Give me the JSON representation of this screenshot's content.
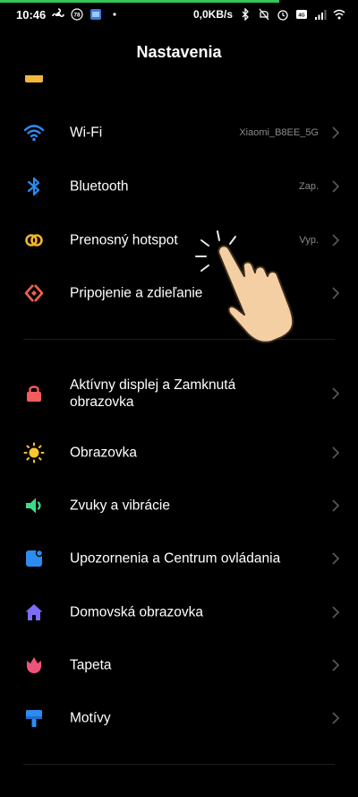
{
  "status_bar": {
    "time": "10:46",
    "badge": "78",
    "speed": "0,0KB/s",
    "progress": 0.78
  },
  "header": {
    "title": "Nastavenia"
  },
  "group1": [
    {
      "icon": "wifi-icon",
      "label": "Wi-Fi",
      "value": "Xiaomi_B8EE_5G",
      "color": "#2d8cf0"
    },
    {
      "icon": "bluetooth-icon",
      "label": "Bluetooth",
      "value": "Zap.",
      "color": "#2d8cf0"
    },
    {
      "icon": "hotspot-icon",
      "label": "Prenosný hotspot",
      "value": "Vyp.",
      "color": "#f2b32a"
    },
    {
      "icon": "share-icon",
      "label": "Pripojenie a zdieľanie",
      "value": "",
      "color": "#f0624f"
    }
  ],
  "group2": [
    {
      "icon": "lock-icon",
      "label": "Aktívny displej a Zamknutá obrazovka",
      "color": "#f25c5c"
    },
    {
      "icon": "brightness-icon",
      "label": "Obrazovka",
      "color": "#f7c531"
    },
    {
      "icon": "speaker-icon",
      "label": "Zvuky a vibrácie",
      "color": "#3ddc84"
    },
    {
      "icon": "notification-icon",
      "label": "Upozornenia a Centrum ovládania",
      "color": "#2d8cf0"
    },
    {
      "icon": "home-icon",
      "label": "Domovská obrazovka",
      "color": "#7d6cf5"
    },
    {
      "icon": "wallpaper-icon",
      "label": "Tapeta",
      "color": "#f0537a"
    },
    {
      "icon": "themes-icon",
      "label": "Motívy",
      "color": "#2d8cf0"
    }
  ]
}
